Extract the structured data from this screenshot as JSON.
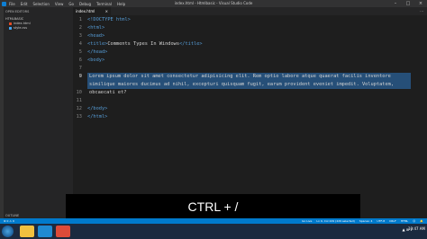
{
  "window": {
    "title": "index.html - Htmlbasic - Visual Studio Code",
    "menu": [
      "File",
      "Edit",
      "Selection",
      "View",
      "Go",
      "Debug",
      "Terminal",
      "Help"
    ]
  },
  "sidebar": {
    "section": "OPEN EDITORS",
    "folder": "HTMLBASIC",
    "files": [
      {
        "name": "index.html",
        "color": "#e44d26"
      },
      {
        "name": "style.css",
        "color": "#42a5f5"
      }
    ],
    "outline": "OUTLINE"
  },
  "tabs": [
    {
      "label": "index.html",
      "close": "×"
    }
  ],
  "editor": {
    "line_numbers": [
      "1",
      "2",
      "3",
      "4",
      "5",
      "6",
      "7",
      "8",
      "9",
      "",
      "10",
      "11",
      "12",
      "13"
    ],
    "code": {
      "l1": "<!DOCTYPE html>",
      "l2": "<html>",
      "l3": "<head>",
      "l4_open": "<title>",
      "l4_text": "Comments Types In Windows",
      "l4_close": "</title>",
      "l5": "</head>",
      "l6": "<body>",
      "l9": "Lorem ipsum dolor sit amet consectetur adipisicing elit. Rem optio labore atque quaerat facilis inventore similique maiores ducimus ad nihil, excepturi quisquam fugit, earum provident eveniet impedit. Voluptatem, obcaecati et?",
      "l12": "</body>",
      "l13": "</html>"
    }
  },
  "overlay": {
    "shortcut": "CTRL + /"
  },
  "statusbar": {
    "left": "⊗ 0 ⚠ 0",
    "items": [
      "Go Live",
      "Ln 9, Col 229 (229 selected)",
      "Spaces: 4",
      "UTF-8",
      "CRLF",
      "HTML",
      "☺",
      "🔔"
    ]
  },
  "taskbar": {
    "apps": [
      {
        "name": "explorer",
        "color": "#f0c040"
      },
      {
        "name": "vscode",
        "color": "#1f8ad2"
      },
      {
        "name": "chrome",
        "color": "#dd4b39"
      }
    ],
    "tray": "▲ ⊞ ♪",
    "time": "10:47 AM"
  },
  "colors": {
    "accent": "#007acc",
    "selection": "#264f78",
    "tag": "#569cd6"
  }
}
